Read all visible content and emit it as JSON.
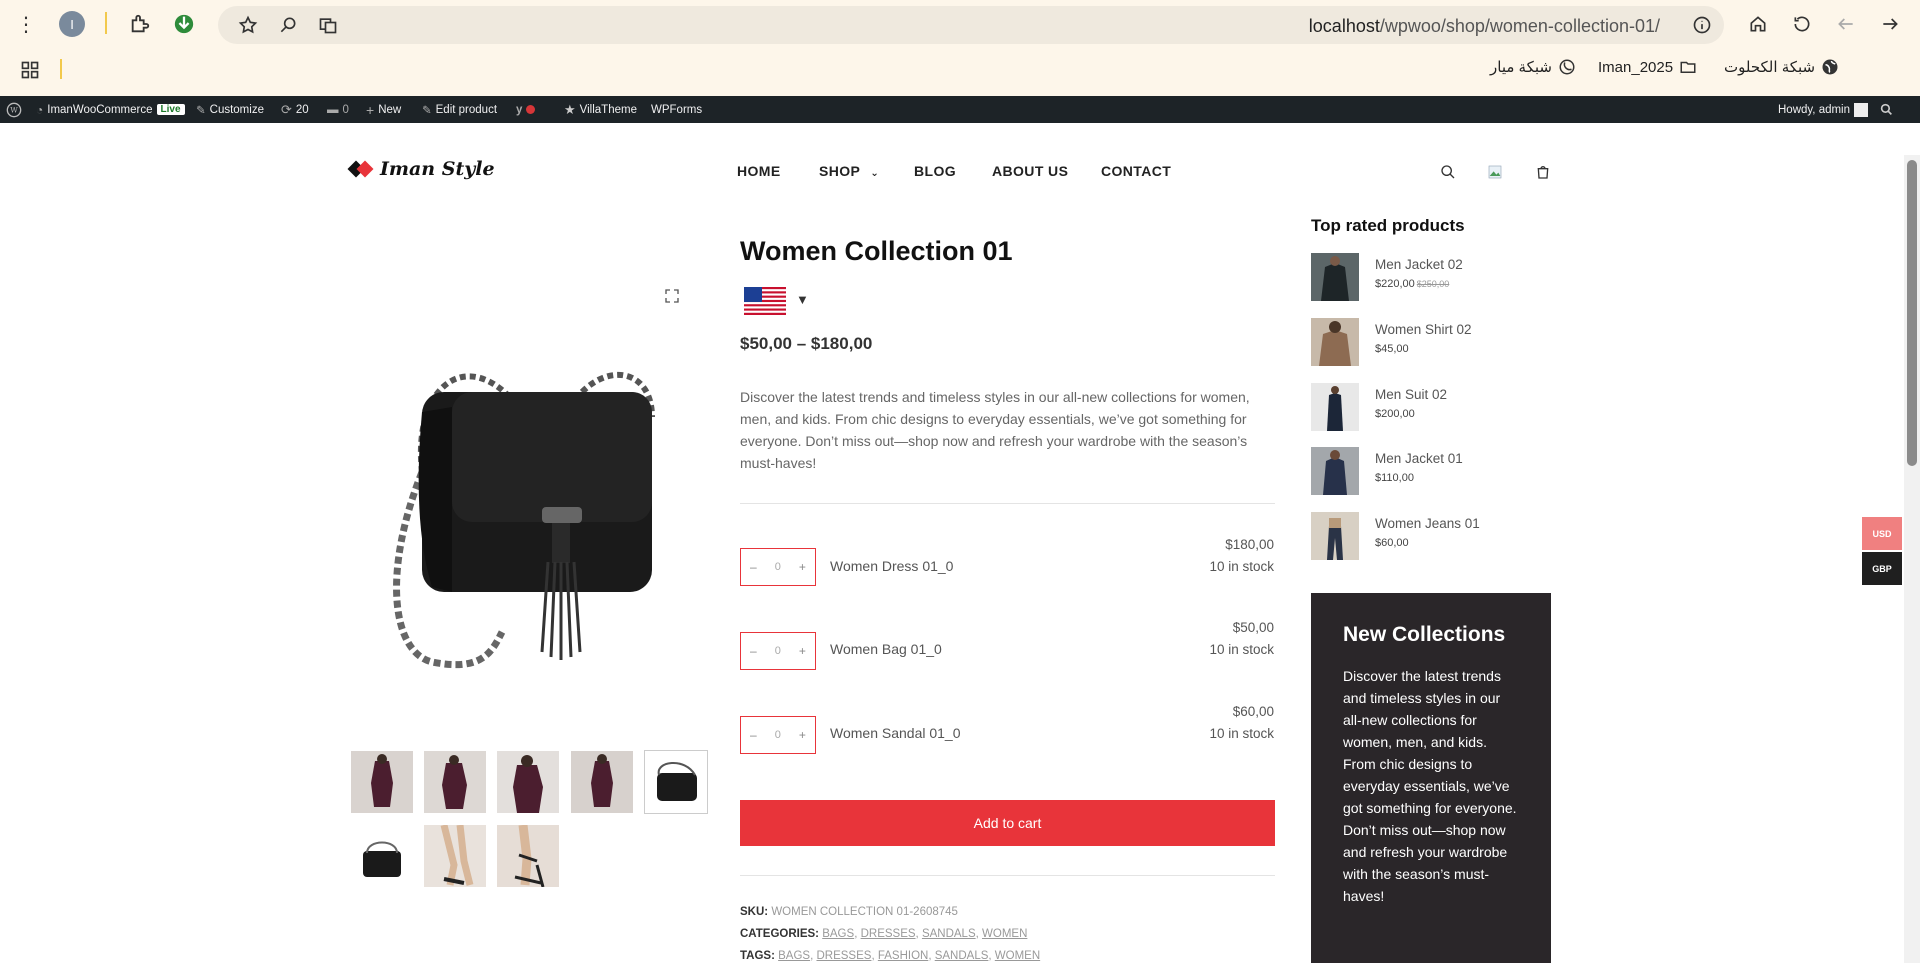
{
  "browser": {
    "profile_initial": "I",
    "url_host": "localhost",
    "url_path": "/wpwoo/shop/women-collection-01/",
    "bookmarks": [
      "شبكة الكحلوت",
      "Iman_2025",
      "شبكة ميار"
    ]
  },
  "admin_bar": {
    "site": "ImanWooCommerce",
    "live": "Live",
    "customize": "Customize",
    "updates": "20",
    "comments": "0",
    "new": "New",
    "edit": "Edit product",
    "villatheme": "VillaTheme",
    "wpforms": "WPForms",
    "howdy": "Howdy, admin"
  },
  "header": {
    "logo": "Iman Style",
    "nav": [
      "HOME",
      "SHOP",
      "BLOG",
      "ABOUT US",
      "CONTACT"
    ]
  },
  "product": {
    "title": "Women Collection 01",
    "price": "$50,00 – $180,00",
    "description": "Discover the latest trends and timeless styles in our all-new collections for women, men, and kids. From chic designs to everyday essentials, we’ve got something for everyone. Don’t miss out—shop now and refresh your wardrobe with the season’s must-haves!",
    "group": [
      {
        "name": "Women Dress 01_0",
        "qty": "0",
        "price": "$180,00",
        "stock": "10 in stock"
      },
      {
        "name": "Women Bag 01_0",
        "qty": "0",
        "price": "$50,00",
        "stock": "10 in stock"
      },
      {
        "name": "Women Sandal 01_0",
        "qty": "0",
        "price": "$60,00",
        "stock": "10 in stock"
      }
    ],
    "add_to_cart": "Add to cart",
    "sku_label": "SKU:",
    "sku": "WOMEN COLLECTION 01-2608745",
    "categories_label": "CATEGORIES:",
    "categories": [
      "BAGS",
      "DRESSES",
      "SANDALS",
      "WOMEN"
    ],
    "tags_label": "TAGS:",
    "tags": [
      "BAGS",
      "DRESSES",
      "FASHION",
      "SANDALS",
      "WOMEN"
    ]
  },
  "sidebar": {
    "title": "Top rated products",
    "items": [
      {
        "name": "Men Jacket 02",
        "price": "$220,00",
        "old_price": "$250,00"
      },
      {
        "name": "Women Shirt 02",
        "price": "$45,00"
      },
      {
        "name": "Men Suit 02",
        "price": "$200,00"
      },
      {
        "name": "Men Jacket 01",
        "price": "$110,00"
      },
      {
        "name": "Women Jeans 01",
        "price": "$60,00"
      }
    ],
    "promo_title": "New Collections",
    "promo_text": "Discover the latest trends and timeless styles in our all-new collections for women, men, and kids. From chic designs to everyday essentials, we’ve got something for everyone. Don’t miss out—shop now and refresh your wardrobe with the season’s must-haves!"
  },
  "currency": {
    "usd": "USD",
    "gbp": "GBP"
  },
  "colors": {
    "accent": "#e8343a",
    "promo_bg": "#2a2629",
    "admin_bar": "#1d2327"
  }
}
